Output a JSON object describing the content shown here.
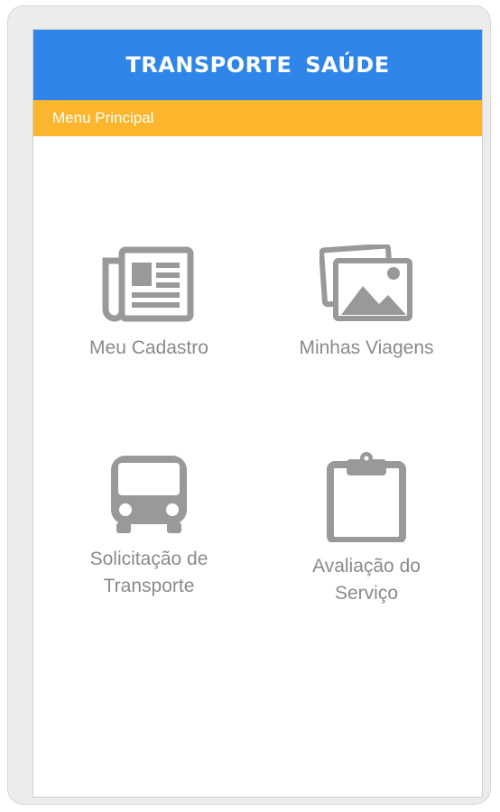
{
  "app": {
    "title": "TRANSPORTE  SAÚDE",
    "subtitle": "Menu Principal"
  },
  "menu": [
    {
      "id": "meu-cadastro",
      "label": "Meu Cadastro",
      "icon": "newspaper-icon"
    },
    {
      "id": "minhas-viagens",
      "label": "Minhas Viagens",
      "icon": "photos-icon"
    },
    {
      "id": "solicitacao-transporte",
      "label_line1": "Solicitação de",
      "label_line2": "Transporte",
      "icon": "bus-icon"
    },
    {
      "id": "avaliacao-servico",
      "label_line1": "Avaliação do",
      "label_line2": "Serviço",
      "icon": "clipboard-icon"
    }
  ],
  "colors": {
    "appbar": "#2f86e8",
    "subbar": "#fbb62d",
    "icon": "#999999",
    "text": "#8a8a8a"
  }
}
